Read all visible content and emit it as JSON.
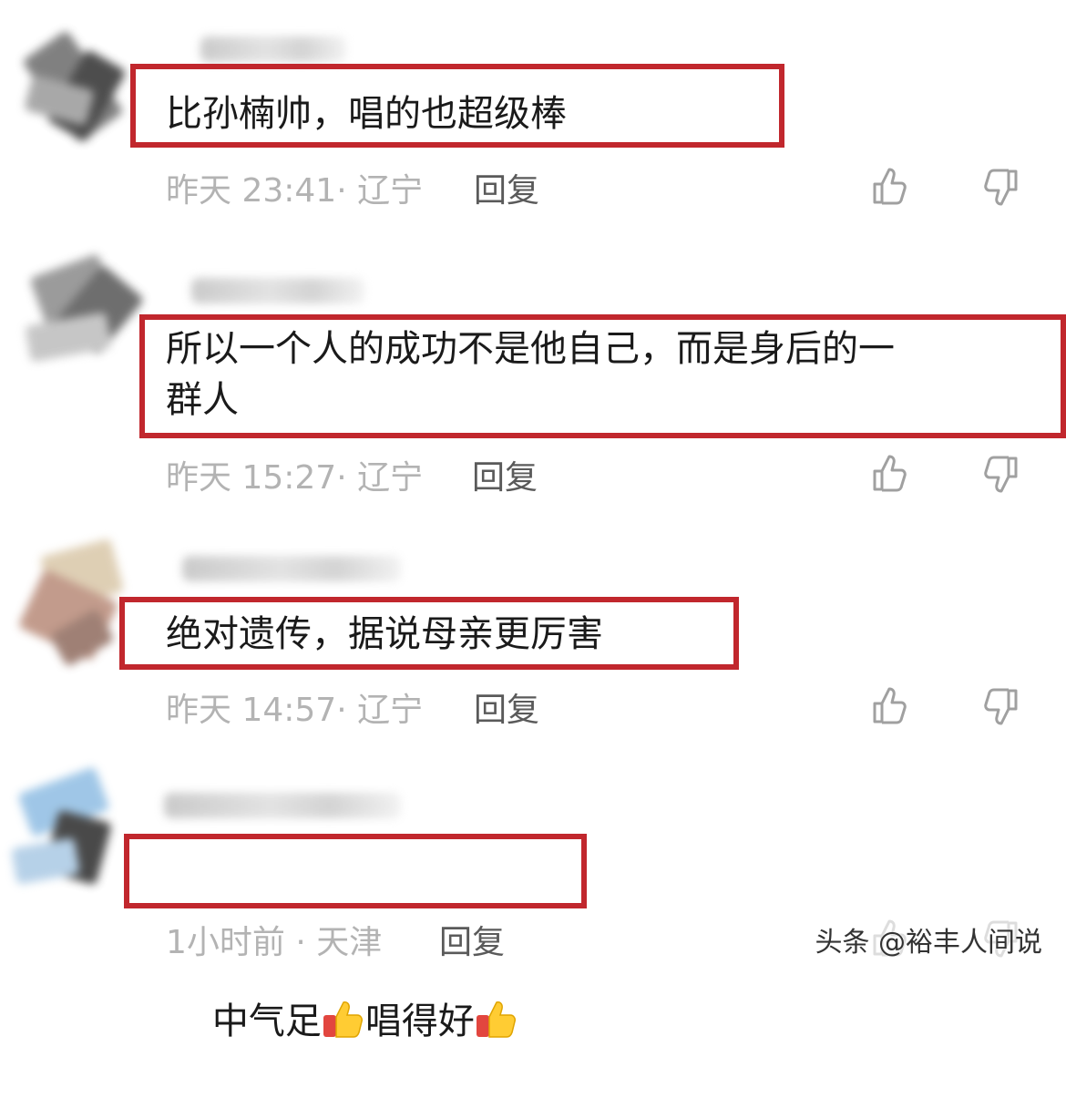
{
  "comments": [
    {
      "text": "比孙楠帅，唱的也超级棒",
      "time_location": "昨天 23:41· 辽宁",
      "reply_label": "回复",
      "like_icon": "thumbs-up-icon",
      "dislike_icon": "thumbs-down-icon"
    },
    {
      "text": "所以一个人的成功不是他自己，而是身后的一\n群人",
      "time_location": "昨天 15:27· 辽宁",
      "reply_label": "回复",
      "like_icon": "thumbs-up-icon",
      "dislike_icon": "thumbs-down-icon"
    },
    {
      "text": "绝对遗传，据说母亲更厉害",
      "time_location": "昨天 14:57· 辽宁",
      "reply_label": "回复",
      "like_icon": "thumbs-up-icon",
      "dislike_icon": "thumbs-down-icon"
    },
    {
      "text_part1": "中气足",
      "text_part2": "唱得好",
      "emoji": "thumbs-up-emoji",
      "time_location": "1小时前 · 天津",
      "reply_label": "回复",
      "like_icon": "thumbs-up-icon",
      "dislike_icon": "thumbs-down-icon"
    }
  ],
  "watermark": "头条 @裕丰人间说",
  "colors": {
    "highlight_box": "#c1272d",
    "meta_text": "#b3b3b3",
    "reply_text": "#5a5a5a",
    "comment_text": "#1a1a1a"
  }
}
